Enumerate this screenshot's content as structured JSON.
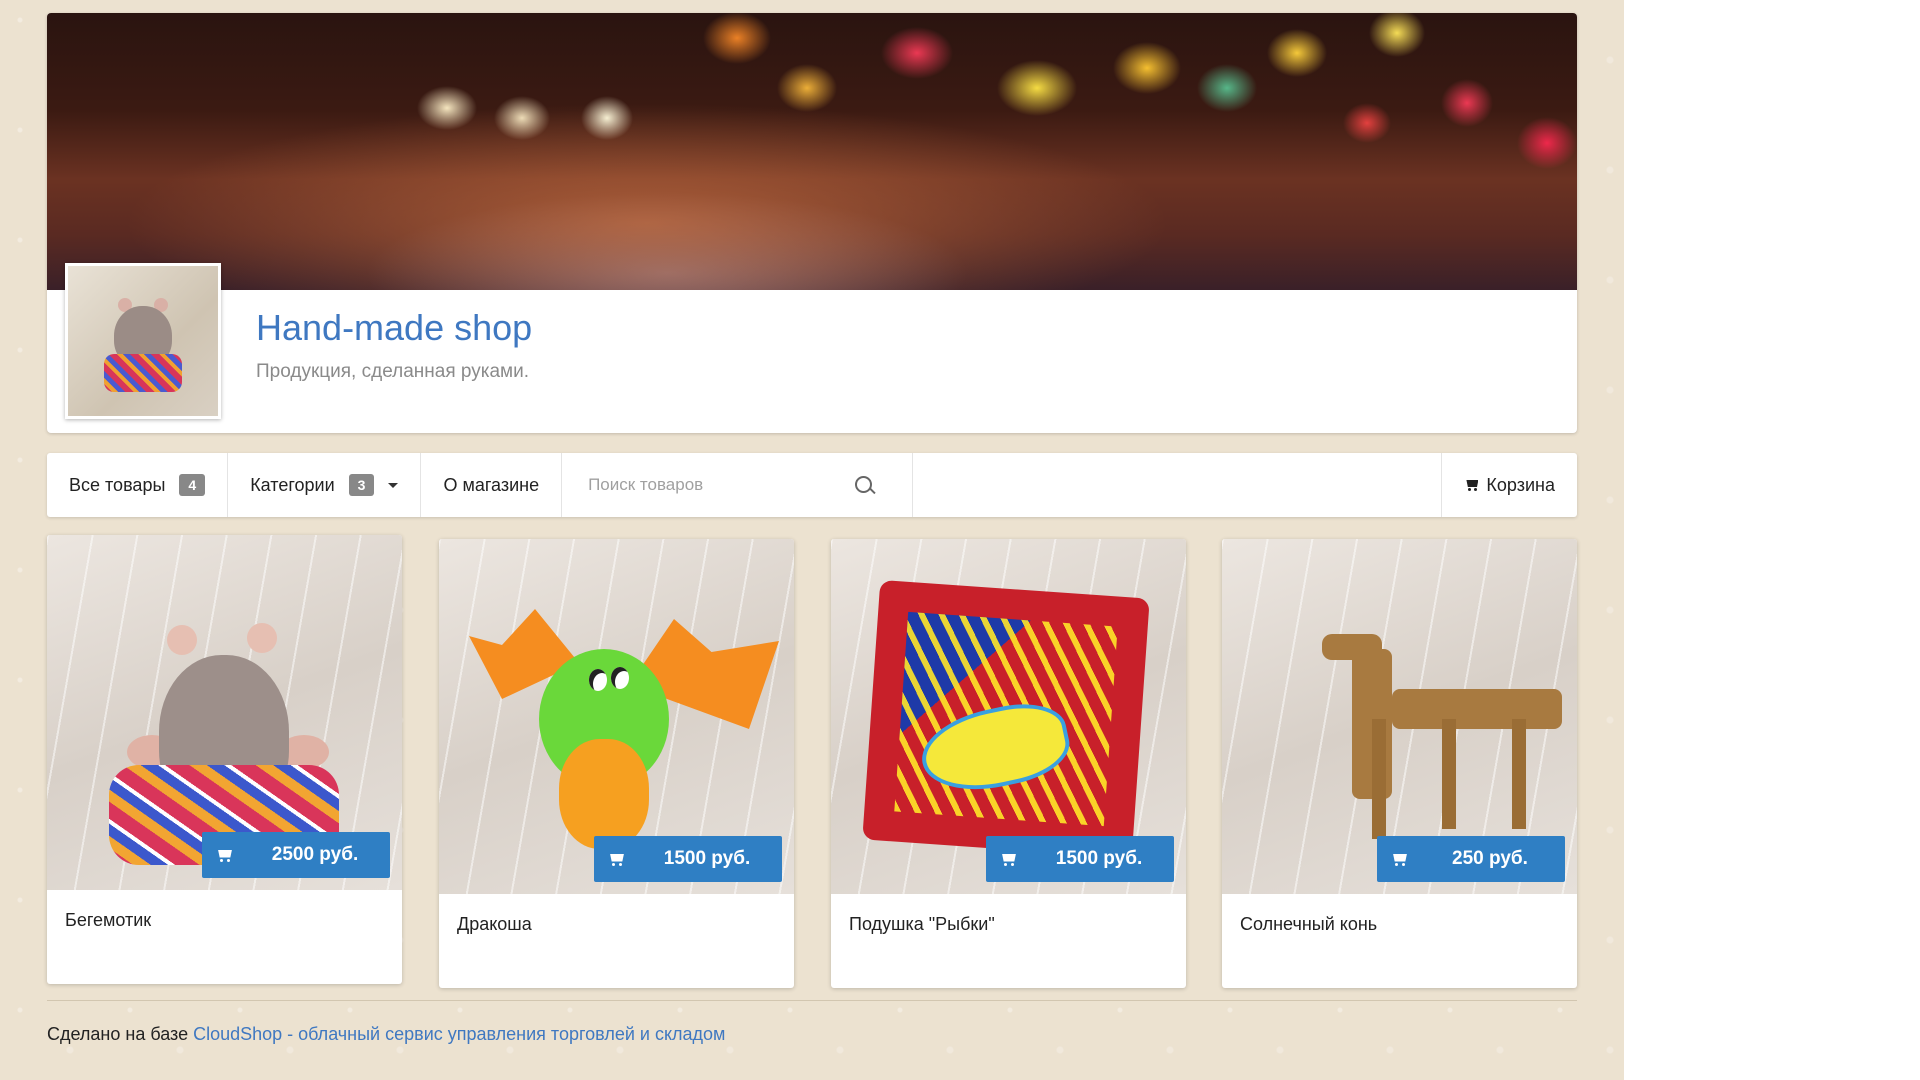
{
  "shop": {
    "title": "Hand-made shop",
    "subtitle": "Продукция, сделанная руками."
  },
  "nav": {
    "all_products": "Все товары",
    "all_products_count": "4",
    "categories": "Категории",
    "categories_count": "3",
    "about": "О магазине",
    "search_placeholder": "Поиск товаров",
    "cart": "Корзина"
  },
  "products": [
    {
      "name": "Бегемотик",
      "price": "2500 руб."
    },
    {
      "name": "Дракоша",
      "price": "1500 руб."
    },
    {
      "name": "Подушка \"Рыбки\"",
      "price": "1500 руб."
    },
    {
      "name": "Солнечный конь",
      "price": "250 руб."
    }
  ],
  "footer": {
    "prefix": "Сделано на базе ",
    "link": "CloudShop - облачный сервис управления торговлей и складом"
  },
  "colors": {
    "accent": "#3f78c1",
    "price_button": "#2f7fc4",
    "page_background": "#ece2d0"
  },
  "icons": {
    "cart": "cart-icon",
    "search": "search-icon",
    "caret": "caret-down-icon"
  }
}
